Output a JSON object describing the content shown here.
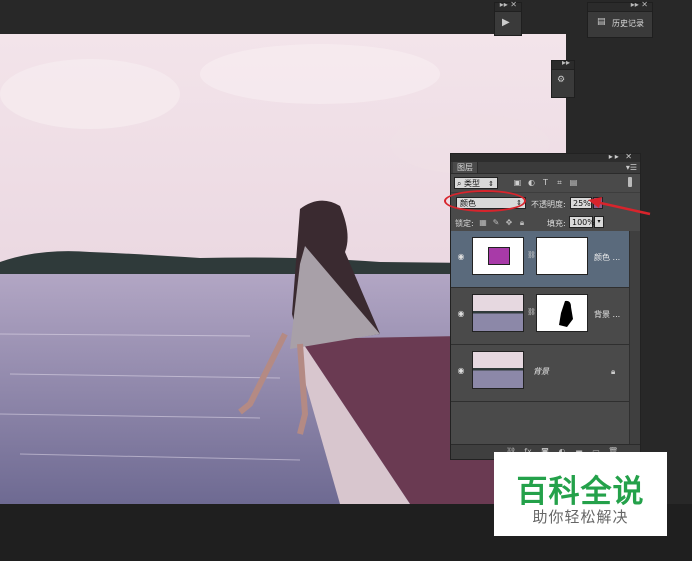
{
  "history_panel": {
    "label": "历史记录",
    "icon": "history-icon"
  },
  "layers_panel": {
    "tab": "图层",
    "kind_filter": "类型",
    "filter_icons": [
      "image-filter-icon",
      "adjustment-filter-icon",
      "type-filter-icon",
      "shape-filter-icon",
      "smartobject-filter-icon"
    ],
    "blend_mode": "颜色",
    "opacity_label": "不透明度:",
    "opacity_value": "25%",
    "lock_label": "锁定:",
    "fill_label": "填充:",
    "fill_value": "100%",
    "layers": [
      {
        "name": "颜色 ...",
        "thumb_color": "#a83aa8",
        "selected": true,
        "visible": true
      },
      {
        "name": "背景 ...",
        "visible": true
      },
      {
        "name": "背景",
        "locked": true,
        "visible": true
      }
    ],
    "bottom_icons": [
      "link-icon",
      "fx-icon",
      "mask-icon",
      "adjustment-icon",
      "folder-icon",
      "new-layer-icon",
      "trash-icon"
    ],
    "fx_label": "fx"
  },
  "watermark": {
    "main": "百科全说",
    "sub": "助你轻松解决"
  },
  "colors": {
    "annotation": "#d8242c",
    "layer_fill": "#a83aa8",
    "watermark_green": "#24a14a"
  }
}
